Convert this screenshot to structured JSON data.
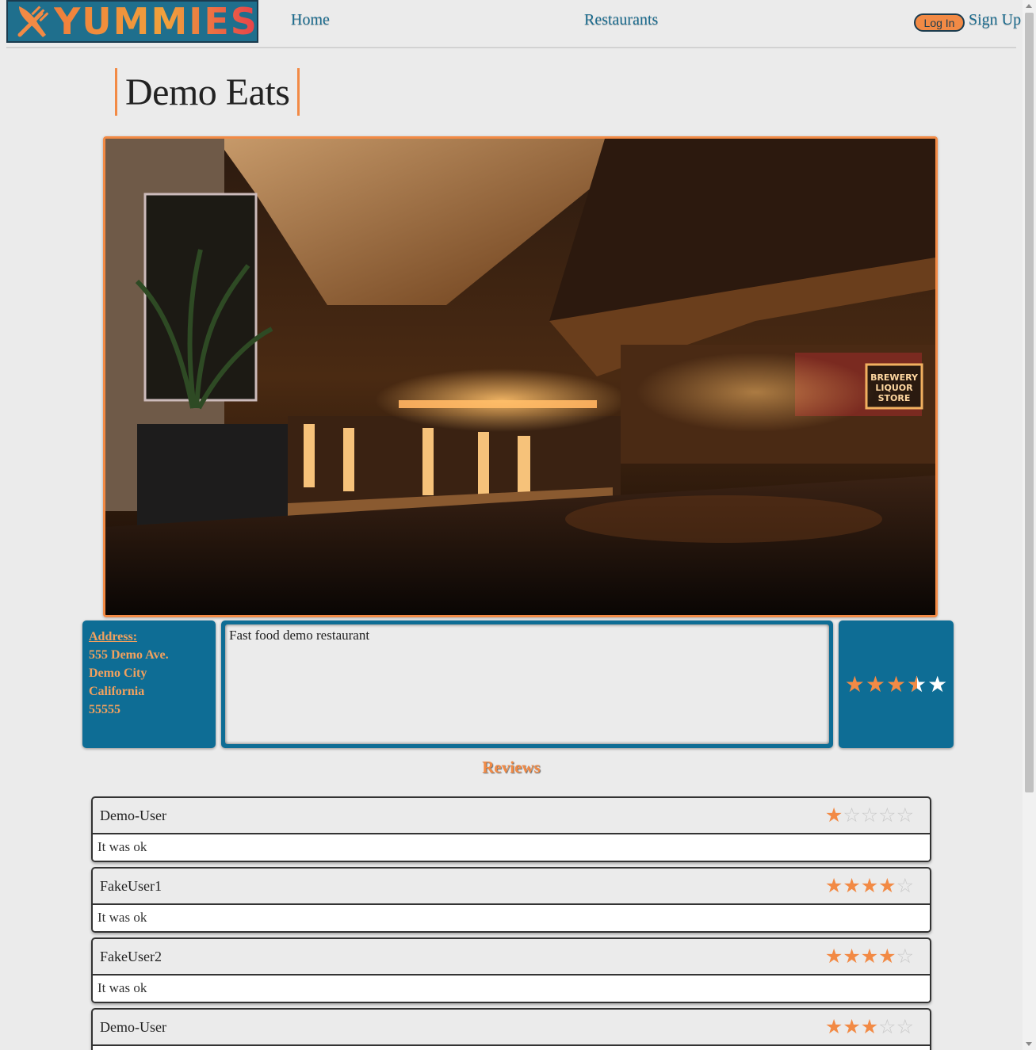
{
  "brand": {
    "name": "YUMMIES",
    "logo_icon": "fork-knife-icon"
  },
  "nav": {
    "home": "Home",
    "restaurants": "Restaurants",
    "login": "Log In",
    "signup": "Sign Up"
  },
  "restaurant": {
    "name": "Demo Eats",
    "address_label": "Address:",
    "street": "555 Demo Ave.",
    "city": "Demo City",
    "state": "California",
    "zip": "55555",
    "description": "Fast food demo restaurant",
    "rating": 3.5
  },
  "reviews_heading": "Reviews",
  "reviews": [
    {
      "user": "Demo-User",
      "rating": 1,
      "text": "It was ok"
    },
    {
      "user": "FakeUser1",
      "rating": 4,
      "text": "It was ok"
    },
    {
      "user": "FakeUser2",
      "rating": 4,
      "text": "It was ok"
    },
    {
      "user": "Demo-User",
      "rating": 3,
      "text": ""
    }
  ],
  "colors": {
    "accent": "#f28a45",
    "primary": "#0e6d95",
    "background": "#ebebeb"
  }
}
